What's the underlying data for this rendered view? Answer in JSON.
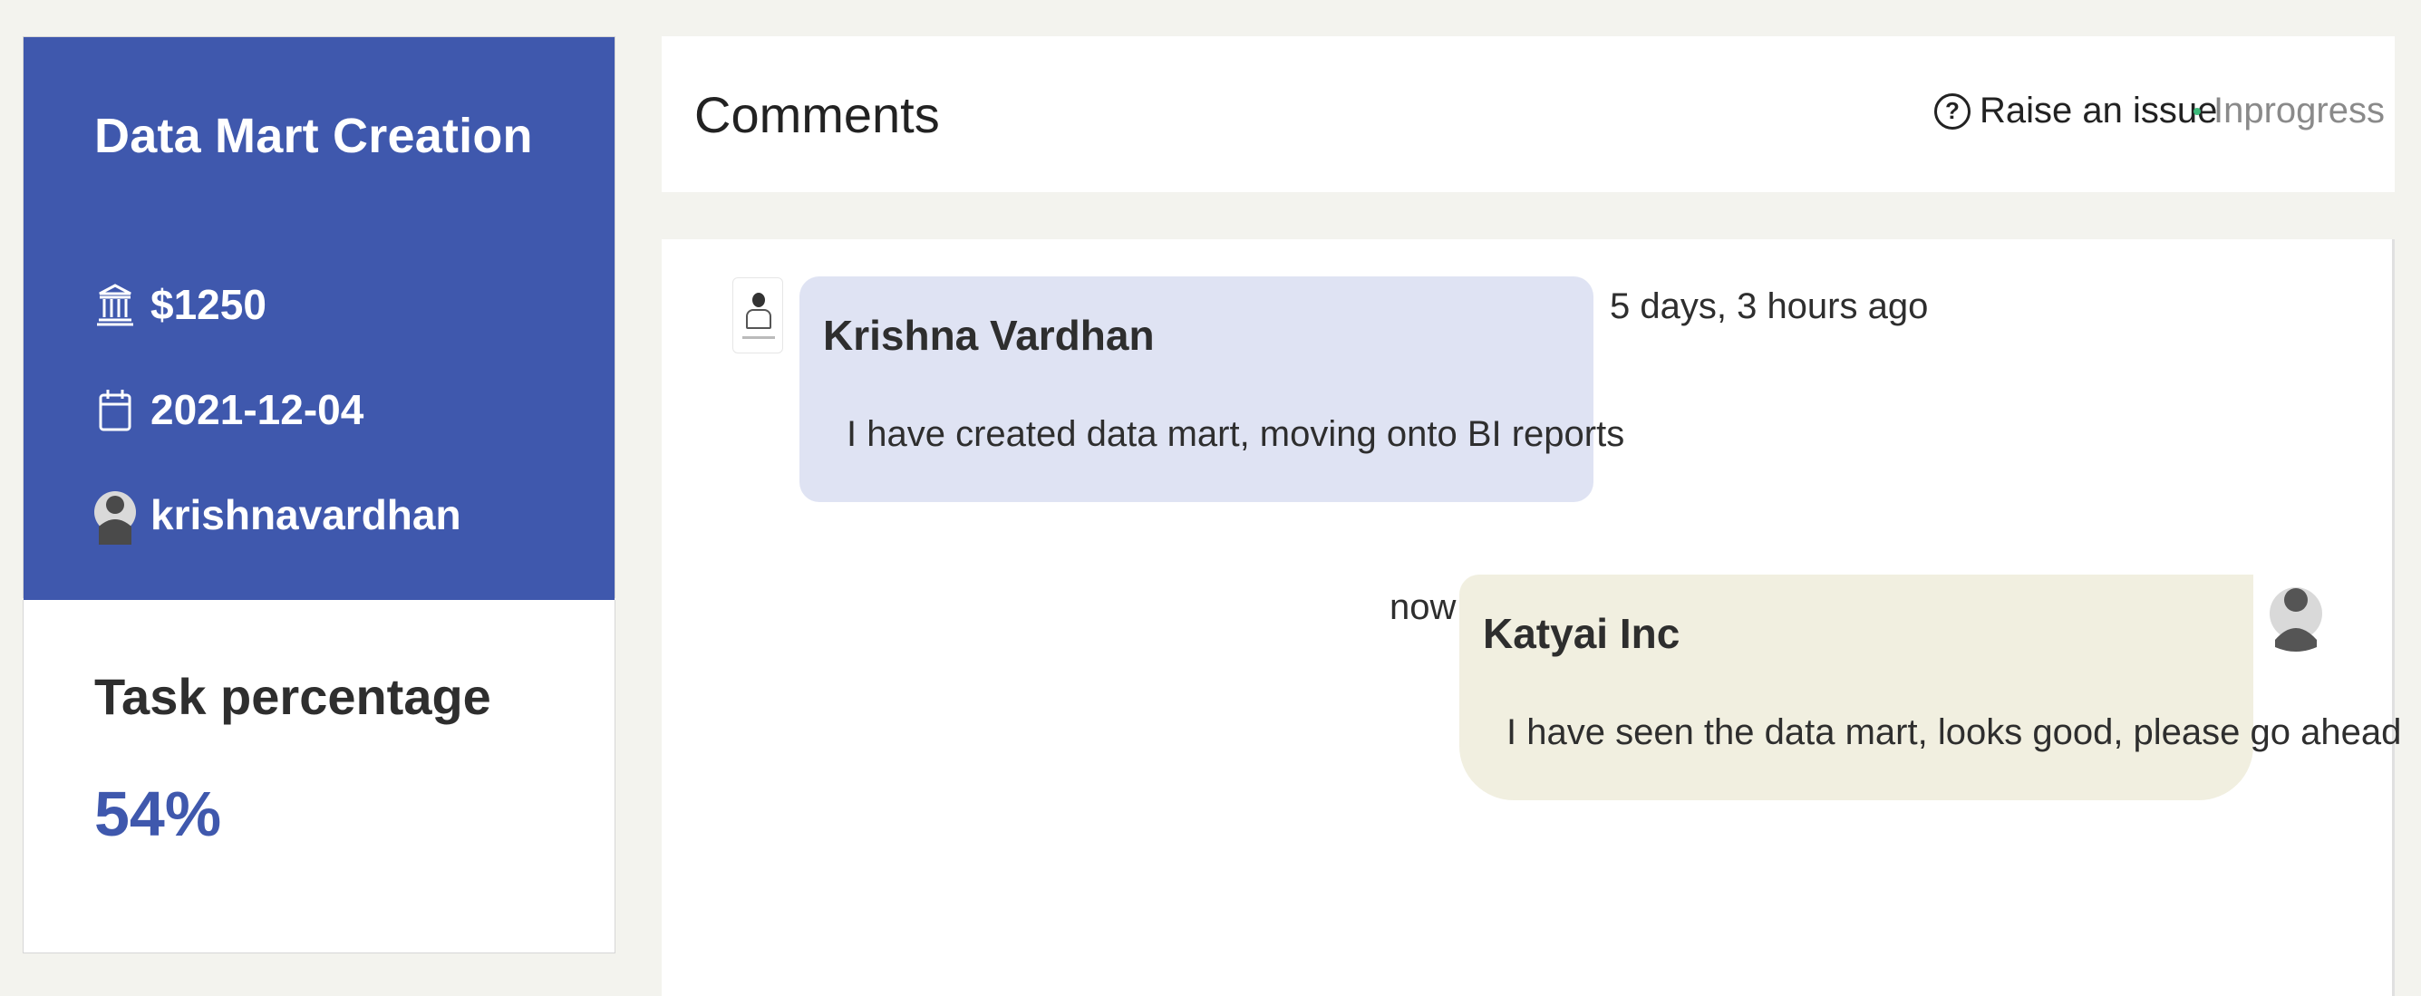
{
  "task": {
    "title": "Data Mart Creation",
    "amount": "$1250",
    "date": "2021-12-04",
    "user": "krishnavardhan",
    "percentage_label": "Task percentage",
    "percentage_value": "54%",
    "icons": {
      "amount": "bank-icon",
      "date": "calendar-icon",
      "user": "user-icon"
    }
  },
  "comments_header": {
    "title": "Comments",
    "raise_issue": "Raise an issue",
    "status": "Inprogress",
    "status_color": "#3cba7a"
  },
  "comments": [
    {
      "author": "Krishna Vardhan",
      "message": "I have created data mart, moving onto BI reports",
      "time": "5 days, 3 hours ago"
    },
    {
      "author": "Katyai Inc",
      "message": "I have seen the data mart, looks good, please go ahead",
      "time": "now"
    }
  ],
  "colors": {
    "accent": "#3f58ad",
    "bubble_left": "#dfe3f3",
    "bubble_right": "#f1efe0",
    "background": "#f3f3ee"
  }
}
